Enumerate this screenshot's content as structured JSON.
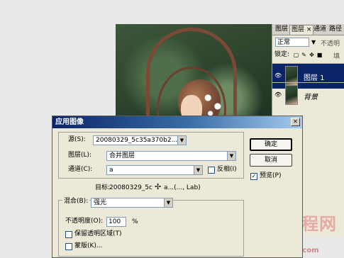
{
  "colors": {
    "titlebar_start": "#0a246a",
    "titlebar_end": "#a6caf0",
    "selection": "#0a246a",
    "dialog_bg": "#ece9d8"
  },
  "layers_panel": {
    "tabs": [
      "图层",
      "图层 ×",
      "通道",
      "路径"
    ],
    "active_tab_index": 1,
    "blend_mode": "正常",
    "opacity_label": "不透明",
    "lock_label": "锁定:",
    "fill_label": "填",
    "lock_icons": [
      "lock-transparent-icon",
      "lock-image-icon",
      "lock-position-icon",
      "lock-all-icon"
    ],
    "layers": [
      {
        "name": "图层 1",
        "selected": true,
        "visible": true
      },
      {
        "name": "背景",
        "selected": false,
        "visible": true
      }
    ]
  },
  "dialog": {
    "title": "应用图像",
    "close_icon": "close-icon",
    "source": {
      "label": "源(S):",
      "value": "20080329_5c35a370b2...",
      "layer_label": "图层(L):",
      "layer_value": "合并图层",
      "channel_label": "通道(C):",
      "channel_value": "a",
      "invert_label": "反相(I)",
      "invert_checked": false
    },
    "target": {
      "label": "目标:",
      "value": "20080329_5c",
      "value_tail": "a...(..., Lab)"
    },
    "blending": {
      "label": "混合(B):",
      "value": "强光",
      "opacity_label": "不透明度(O):",
      "opacity_value": "100",
      "opacity_unit": "%",
      "preserve_label": "保留透明区域(T)",
      "preserve_checked": false,
      "mask_label": "蒙版(K)...",
      "mask_checked": false
    },
    "buttons": {
      "ok": "确定",
      "cancel": "取消"
    },
    "preview": {
      "label": "预览(P)",
      "checked": true
    }
  },
  "watermark": {
    "text": "中国教程网",
    "url": "www.jcwcn.com"
  }
}
